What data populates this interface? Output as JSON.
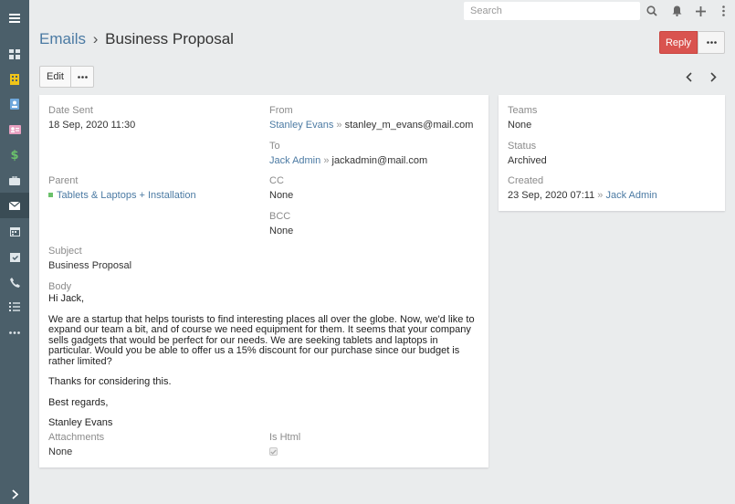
{
  "sidebar": {
    "items": [
      {
        "name": "menu-icon"
      },
      {
        "name": "dashboard-icon"
      },
      {
        "name": "accounts-icon"
      },
      {
        "name": "contacts-icon"
      },
      {
        "name": "leads-icon"
      },
      {
        "name": "opportunities-icon"
      },
      {
        "name": "cases-icon"
      },
      {
        "name": "emails-icon",
        "active": true
      },
      {
        "name": "calendar-icon"
      },
      {
        "name": "meetings-icon"
      },
      {
        "name": "calls-icon"
      },
      {
        "name": "tasks-icon"
      },
      {
        "name": "more-icon"
      },
      {
        "name": "expand-icon"
      }
    ]
  },
  "topbar": {
    "search_placeholder": "Search"
  },
  "header": {
    "breadcrumb_link": "Emails",
    "separator": "›",
    "title": "Business Proposal",
    "reply_label": "Reply",
    "edit_label": "Edit"
  },
  "record": {
    "date_sent_label": "Date Sent",
    "date_sent": "18 Sep, 2020 11:30",
    "from_label": "From",
    "from_name": "Stanley Evans",
    "from_email": "stanley_m_evans@mail.com",
    "to_label": "To",
    "to_name": "Jack Admin",
    "to_email": "jackadmin@mail.com",
    "parent_label": "Parent",
    "parent_value": "Tablets & Laptops + Installation",
    "cc_label": "CC",
    "cc_value": "None",
    "bcc_label": "BCC",
    "bcc_value": "None",
    "subject_label": "Subject",
    "subject_value": "Business Proposal",
    "body_label": "Body",
    "body": {
      "greeting": "Hi Jack,",
      "paragraph": "We are a startup that helps tourists to find interesting places all over the globe. Now, we'd like to expand our team a bit, and of course we need equipment for them. It seems that your company sells gadgets that would be perfect for our needs. We are seeking tablets and laptops in particular. Would you be able to offer us a 15% discount for our purchase since our budget is rather limited?",
      "thanks": "Thanks for considering this.",
      "closing": "Best regards,",
      "signature": "Stanley Evans"
    },
    "attachments_label": "Attachments",
    "attachments_value": "None",
    "is_html_label": "Is Html",
    "is_html_checked": true
  },
  "side": {
    "teams_label": "Teams",
    "teams_value": "None",
    "status_label": "Status",
    "status_value": "Archived",
    "created_label": "Created",
    "created_value": "23 Sep, 2020 07:11",
    "created_by": "Jack Admin"
  },
  "arrow_sep": "»",
  "colors": {
    "sidebar": "#4b5f6a",
    "accent_link": "#4b7aa3",
    "reply_button": "#d9534f",
    "icon_yellow": "#f0c419",
    "icon_blue": "#6fa8dc",
    "icon_pink": "#e8a0c0",
    "icon_green": "#6bc16b"
  }
}
